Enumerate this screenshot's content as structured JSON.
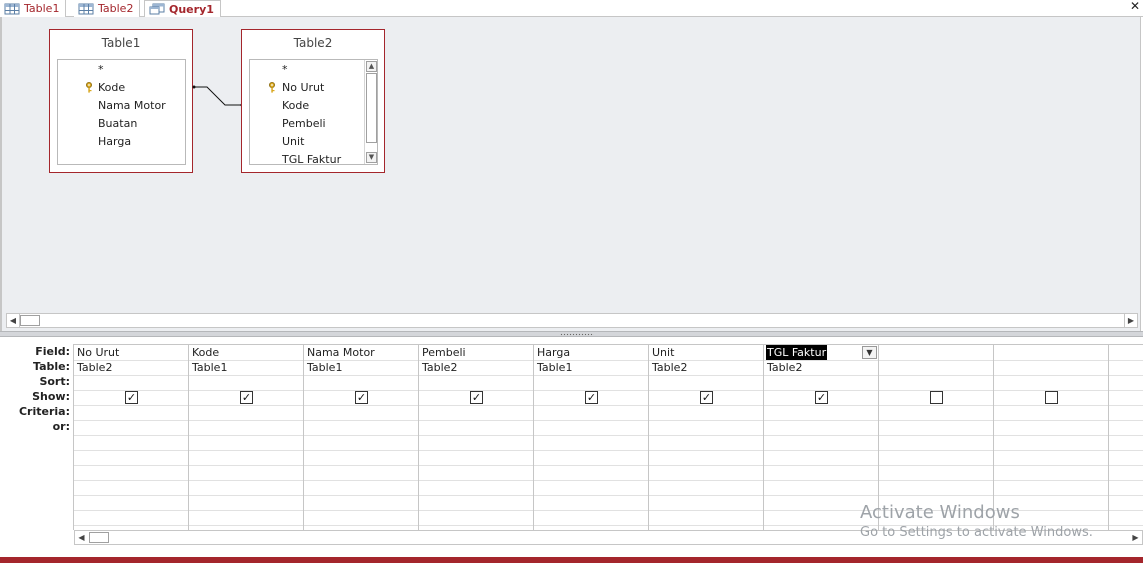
{
  "tabs": [
    {
      "label": "Table1",
      "icon": "table-icon"
    },
    {
      "label": "Table2",
      "icon": "table-icon"
    },
    {
      "label": "Query1",
      "icon": "query-icon"
    }
  ],
  "close_label": "✕",
  "tables": [
    {
      "title": "Table1",
      "fields": [
        "*",
        "Kode",
        "Nama Motor",
        "Buatan",
        "Harga"
      ],
      "key_field_index": 1
    },
    {
      "title": "Table2",
      "fields": [
        "*",
        "No Urut",
        "Kode",
        "Pembeli",
        "Unit",
        "TGL Faktur"
      ],
      "key_field_index": 1
    }
  ],
  "grid": {
    "row_labels": {
      "field": "Field:",
      "table": "Table:",
      "sort": "Sort:",
      "show": "Show:",
      "criteria": "Criteria:",
      "or": "or:"
    },
    "columns": [
      {
        "field": "No Urut",
        "table": "Table2",
        "show": true
      },
      {
        "field": "Kode",
        "table": "Table1",
        "show": true
      },
      {
        "field": "Nama Motor",
        "table": "Table1",
        "show": true
      },
      {
        "field": "Pembeli",
        "table": "Table2",
        "show": true
      },
      {
        "field": "Harga",
        "table": "Table1",
        "show": true
      },
      {
        "field": "Unit",
        "table": "Table2",
        "show": true
      },
      {
        "field": "TGL Faktur",
        "table": "Table2",
        "show": true
      },
      {
        "field": "",
        "table": "",
        "show": false
      },
      {
        "field": "",
        "table": "",
        "show": false
      }
    ],
    "check_mark": "✓"
  },
  "watermark": {
    "line1": "Activate Windows",
    "line2": "Go to Settings to activate Windows."
  },
  "colors": {
    "accent": "#a4262c",
    "design_bg": "#eceef1"
  }
}
